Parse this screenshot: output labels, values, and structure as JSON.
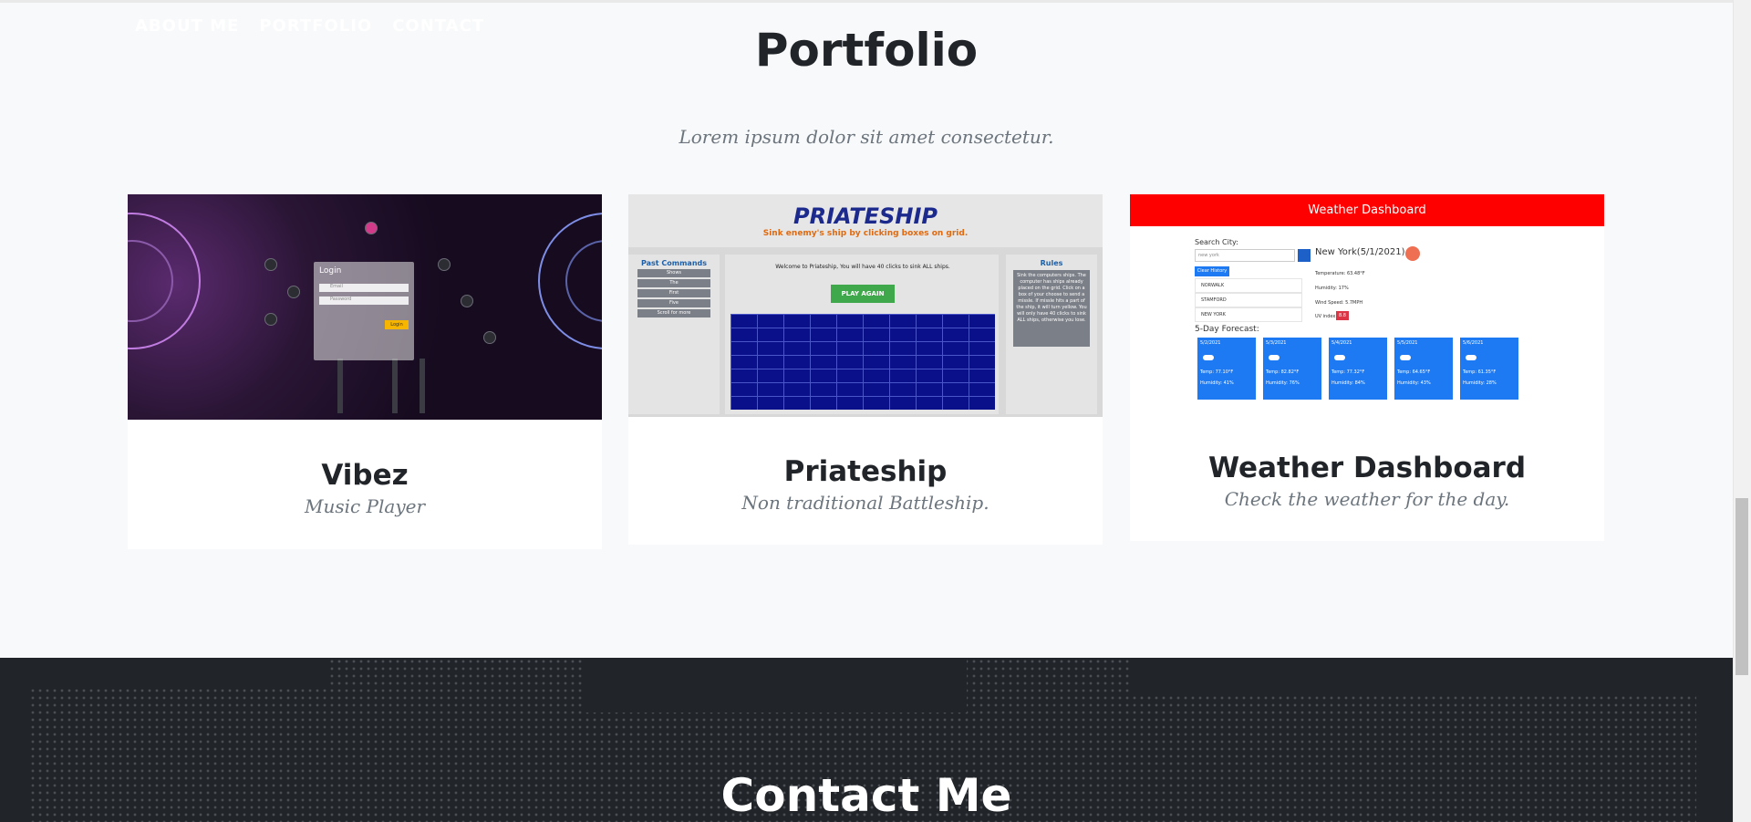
{
  "nav": {
    "items": [
      {
        "label": "ABOUT ME"
      },
      {
        "label": "PORTFOLIO"
      },
      {
        "label": "CONTACT"
      }
    ]
  },
  "portfolio": {
    "title": "Portfolio",
    "subtitle": "Lorem ipsum dolor sit amet consectetur.",
    "cards": [
      {
        "title": "Vibez",
        "subtitle": "Music Player",
        "thumb": {
          "login_title": "Login",
          "email_placeholder": "Email",
          "password_placeholder": "Password",
          "login_button": "Login"
        }
      },
      {
        "title": "Priateship",
        "subtitle": "Non traditional Battleship.",
        "thumb": {
          "heading": "PRIATESHIP",
          "tagline": "Sink enemy's ship by clicking boxes on grid.",
          "past_commands_title": "Past Commands",
          "commands": [
            "Shows",
            "The",
            "First",
            "Five",
            "Scroll for more"
          ],
          "welcome": "Welcome to Priateship, You will have 40 clicks to sink ALL ships.",
          "play_again": "PLAY AGAIN",
          "rules_title": "Rules",
          "rules_text": "Sink the computers ships. The computer has ships already placed on the grid. Click on a box of your choose to send a missle. If missle hits a part of the ship, it will turn yellow. You will only have 40 clicks to sink ALL ships, otherwise you lose."
        }
      },
      {
        "title": "Weather Dashboard",
        "subtitle": "Check the weather for the day.",
        "thumb": {
          "header": "Weather Dashboard",
          "search_label": "Search City:",
          "search_value": "new york",
          "clear_history": "Clear History",
          "history": [
            "NORWALK",
            "STAMFORD",
            "NEW YORK"
          ],
          "city_title": "New York(5/1/2021)",
          "temperature": "Temperature: 63.48°F",
          "humidity": "Humidity: 17%",
          "wind": "Wind Speed: 5.7MPH",
          "uv_label": "UV index:",
          "uv_value": "8.8",
          "forecast_title": "5-Day Forecast:",
          "forecast": [
            {
              "date": "5/2/2021",
              "temp": "Temp: 77.10°F",
              "humidity": "Humidity: 41%"
            },
            {
              "date": "5/3/2021",
              "temp": "Temp: 82.82°F",
              "humidity": "Humidity: 76%"
            },
            {
              "date": "5/4/2021",
              "temp": "Temp: 77.32°F",
              "humidity": "Humidity: 84%"
            },
            {
              "date": "5/5/2021",
              "temp": "Temp: 64.65°F",
              "humidity": "Humidity: 43%"
            },
            {
              "date": "5/6/2021",
              "temp": "Temp: 61.35°F",
              "humidity": "Humidity: 28%"
            }
          ]
        }
      }
    ]
  },
  "contact": {
    "title": "Contact Me"
  },
  "colors": {
    "background": "#f8f9fa",
    "dark_section": "#212529",
    "weather_header": "#ff0000",
    "forecast_blue": "#1d7af3",
    "play_again_green": "#3fa84a"
  }
}
